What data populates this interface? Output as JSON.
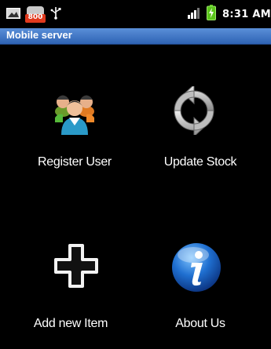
{
  "status_bar": {
    "notification_badge": "800",
    "time": "8:31 AM",
    "icons": [
      "picture-icon",
      "notification-app-icon",
      "usb-icon",
      "signal-icon",
      "battery-icon"
    ]
  },
  "title_bar": {
    "title": "Mobile server"
  },
  "tiles": [
    {
      "label": "Register User",
      "icon": "users-icon"
    },
    {
      "label": "Update Stock",
      "icon": "refresh-icon"
    },
    {
      "label": "Add new Item",
      "icon": "plus-icon"
    },
    {
      "label": "About Us",
      "icon": "info-icon"
    }
  ],
  "colors": {
    "background": "#000000",
    "title_bar": "#3a72c4",
    "battery": "#5ac41a"
  }
}
